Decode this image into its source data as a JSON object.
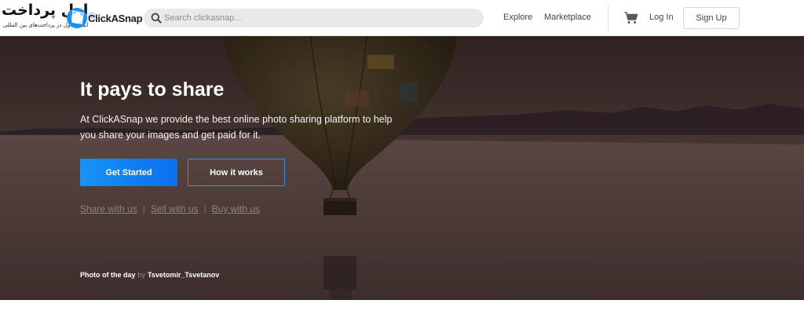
{
  "watermark": {
    "title": "اول پرداخت",
    "subtitle": "انتخاب اول در پرداخت‌های بین المللی"
  },
  "brand": {
    "name": "ClickASnap",
    "accent": "#1e90f5",
    "logo_icon": "camera-aperture-icon"
  },
  "search": {
    "placeholder": "Search clickasnap...",
    "value": "",
    "icon": "search-icon"
  },
  "nav": {
    "explore": "Explore",
    "marketplace": "Marketplace",
    "cart_icon": "shopping-cart-icon",
    "login": "Log In",
    "signup": "Sign Up"
  },
  "hero": {
    "title": "It pays to share",
    "description": "At ClickASnap we provide the best online photo sharing platform to help you share your images and get paid for it.",
    "primary_button": "Get Started",
    "secondary_button": "How it works",
    "links": [
      "Share with us",
      "Sell with us",
      "Buy with us"
    ],
    "link_separator": "|",
    "photo_of_day_label": "Photo of the day",
    "by_label": "by",
    "photographer": "Tsvetomir_Tsvetanov",
    "button_color": "#1893f5"
  }
}
